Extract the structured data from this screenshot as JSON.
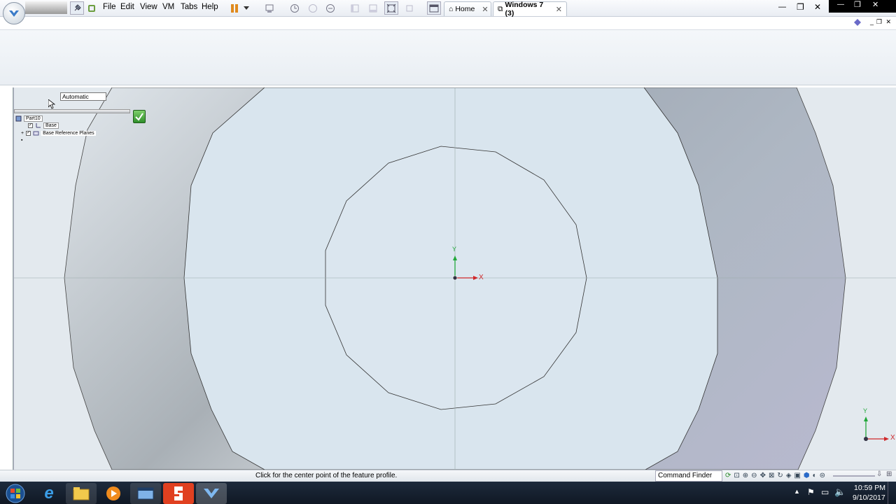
{
  "vm_menu": {
    "items": [
      "File",
      "Edit",
      "View",
      "VM",
      "Tabs",
      "Help"
    ]
  },
  "vm_tabs": [
    {
      "label": "Home",
      "icon": "home-icon",
      "close": "✕"
    },
    {
      "label": "Windows 7 (3)",
      "icon": "vm-icon",
      "close": "✕"
    }
  ],
  "window_controls": {
    "minimize": "—",
    "restore": "❐",
    "close": "✕"
  },
  "sketch": {
    "orientation_combo": "Automatic",
    "tree": {
      "root": "Part10",
      "items": [
        "Base",
        "Base Reference Planes"
      ]
    },
    "axis_x": "X",
    "axis_y": "Y"
  },
  "status": {
    "prompt": "Click for the center point of the feature profile.",
    "command_finder": "Command Finder"
  },
  "taskbar": {
    "time": "10:59 PM",
    "date": "9/10/2017"
  },
  "colors": {
    "viewport_bg": "#dfe7ee",
    "part_face": "#d7e4ee",
    "axis_x": "#d0282a",
    "axis_y": "#22a83a"
  }
}
